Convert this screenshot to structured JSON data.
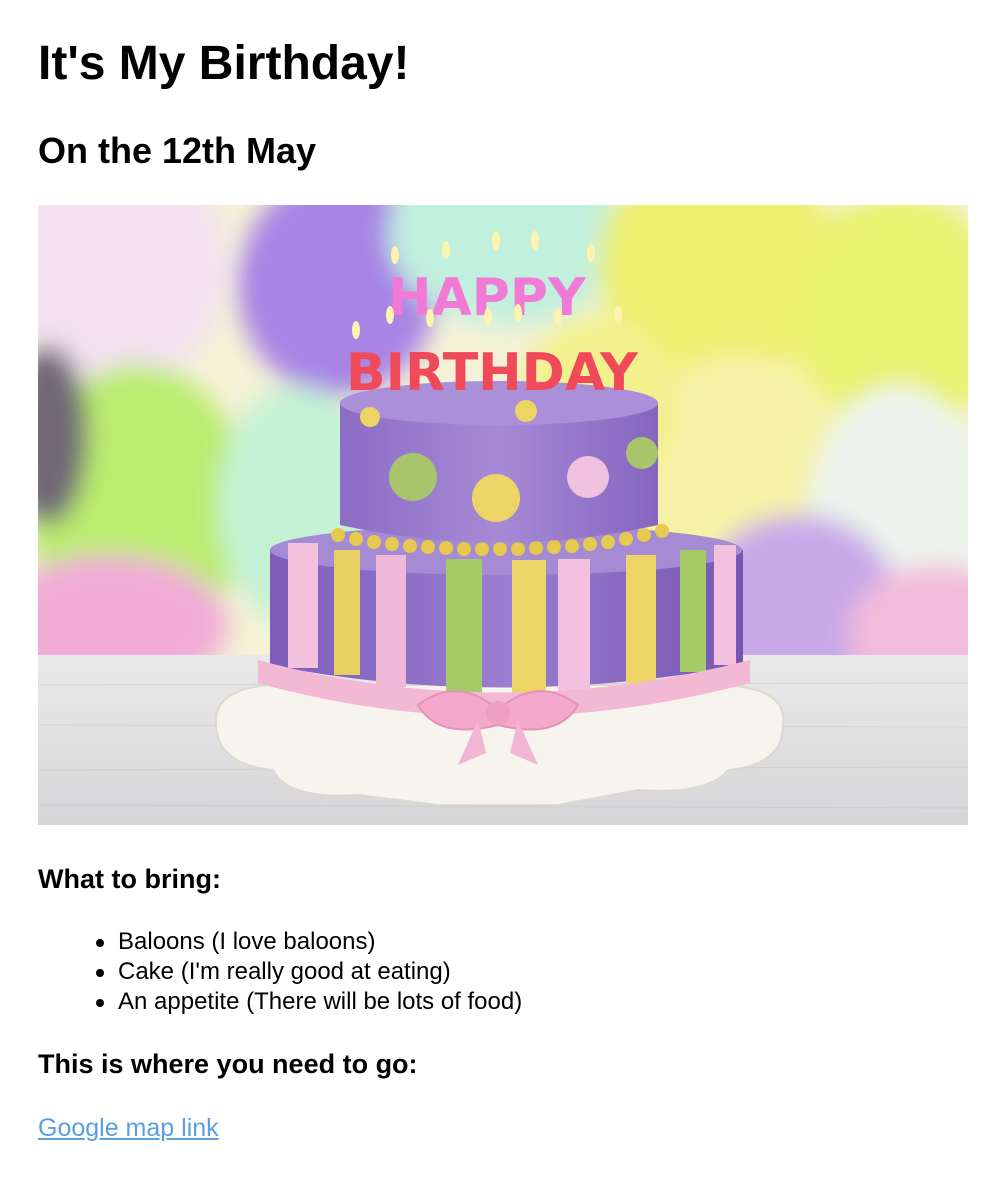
{
  "heading": "It's My Birthday!",
  "subheading": "On the 12th May",
  "image": {
    "alt": "Birthday cake",
    "cake_lettering_top": "HAPPY",
    "cake_lettering_bottom": "BIRTHDAY"
  },
  "bring_heading": "What to bring:",
  "bring_items": [
    "Baloons (I love baloons)",
    "Cake (I'm really good at eating)",
    "An appetite (There will be lots of food)"
  ],
  "where_heading": "This is where you need to go:",
  "map_link_label": "Google map link",
  "colors": {
    "link": "#5a9fe0",
    "text": "#000000"
  }
}
